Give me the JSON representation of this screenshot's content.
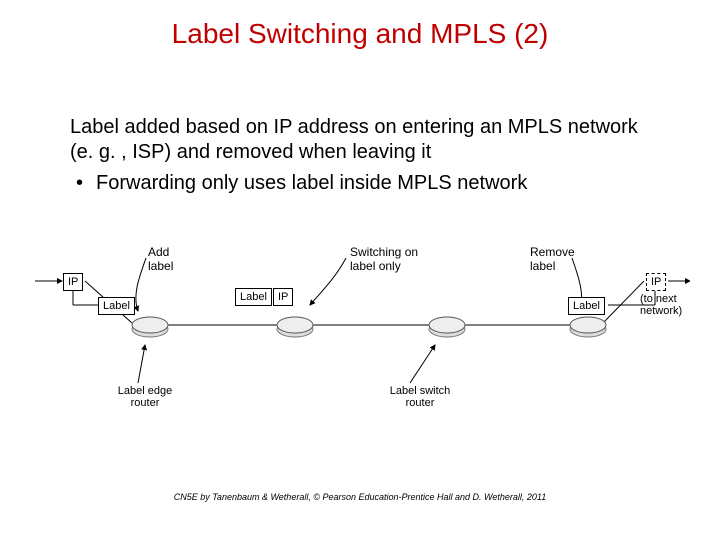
{
  "title": "Label Switching and MPLS (2)",
  "body": {
    "line1": "Label added based on IP address on entering an MPLS network (e. g. , ISP) and removed when leaving it",
    "bullet1": "Forwarding only uses label inside MPLS network"
  },
  "diagram": {
    "ip_left": "IP",
    "label_left": "Label",
    "ip_mid": "IP",
    "label_mid": "Label",
    "label_right": "Label",
    "ip_right": "IP",
    "add_label": "Add label",
    "switch_label": "Switching on label only",
    "remove_label": "Remove label",
    "ler": "Label edge router",
    "lsr": "Label switch router",
    "to_next": "(to next network)"
  },
  "footer": "CN5E by Tanenbaum & Wetherall, © Pearson Education-Prentice Hall and D. Wetherall, 2011"
}
